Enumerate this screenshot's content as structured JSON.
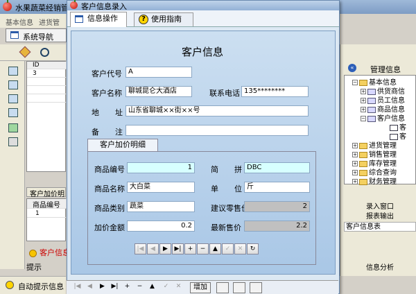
{
  "main_window": {
    "title": "水果蔬菜经销管",
    "menu": [
      "基本信息",
      "进货管"
    ],
    "nav_tab": "系统导航",
    "grid_header": "ID",
    "grid_first_value": "3",
    "customer_tab": "客户加价明",
    "grid2_header": "商品编号",
    "grid2_value": "1",
    "warning_text": "客户信息",
    "hint_label": "提示",
    "auto_hint": "自动提示信息"
  },
  "right_panel": {
    "header": "管理信息",
    "tree": [
      {
        "label": "基本信息",
        "level": 0,
        "expanded": true
      },
      {
        "label": "供货商信",
        "level": 1
      },
      {
        "label": "员工信息",
        "level": 1
      },
      {
        "label": "商品信息",
        "level": 1
      },
      {
        "label": "客户信息",
        "level": 1,
        "expanded": true
      },
      {
        "label": "客",
        "level": 2
      },
      {
        "label": "客",
        "level": 2
      },
      {
        "label": "进货管理",
        "level": 0
      },
      {
        "label": "销售管理",
        "level": 0
      },
      {
        "label": "库存管理",
        "level": 0
      },
      {
        "label": "综合查询",
        "level": 0
      },
      {
        "label": "财务管理",
        "level": 0
      }
    ],
    "buttons": [
      "录入窗口",
      "报表输出",
      "客户信息表"
    ],
    "footer": "信息分析"
  },
  "dialog": {
    "title": "客户信息录入",
    "tabs": [
      "信息操作",
      "使用指南"
    ],
    "form_title": "客户信息",
    "fields": {
      "code_label": "客户代号",
      "code_value": "A",
      "name_label": "客户名称",
      "name_value": "聊城昆仑大酒店",
      "phone_label": "联系电话",
      "phone_value": "135********",
      "address_label_1": "地",
      "address_label_2": "址",
      "address_value": "山东省聊城××街××号",
      "remark_label_1": "备",
      "remark_label_2": "注",
      "remark_value": ""
    },
    "sub_tab": "客户加价明细",
    "detail": {
      "item_code_label": "商品编号",
      "item_code_value": "1",
      "pinyin_label_1": "简",
      "pinyin_label_2": "拼",
      "pinyin_value": "DBC",
      "item_name_label": "商品名称",
      "item_name_value": "大白菜",
      "unit_label_1": "单",
      "unit_label_2": "位",
      "unit_value": "斤",
      "category_label": "商品类别",
      "category_value": "蔬菜",
      "suggested_price_label": "建议零售价",
      "suggested_price_value": "2",
      "markup_label": "加价金额",
      "markup_value": "0.2",
      "latest_price_label": "最新售价",
      "latest_price_value": "2.2"
    },
    "nav_buttons": [
      "|◀",
      "◀",
      "▶",
      "▶|",
      "+",
      "−",
      "▲",
      "✓",
      "✕",
      "↻"
    ],
    "bottom_nav": [
      "|◀",
      "◀",
      "▶",
      "▶|",
      "+",
      "−",
      "▲",
      "✓",
      "✕"
    ],
    "add_button": "增加"
  }
}
